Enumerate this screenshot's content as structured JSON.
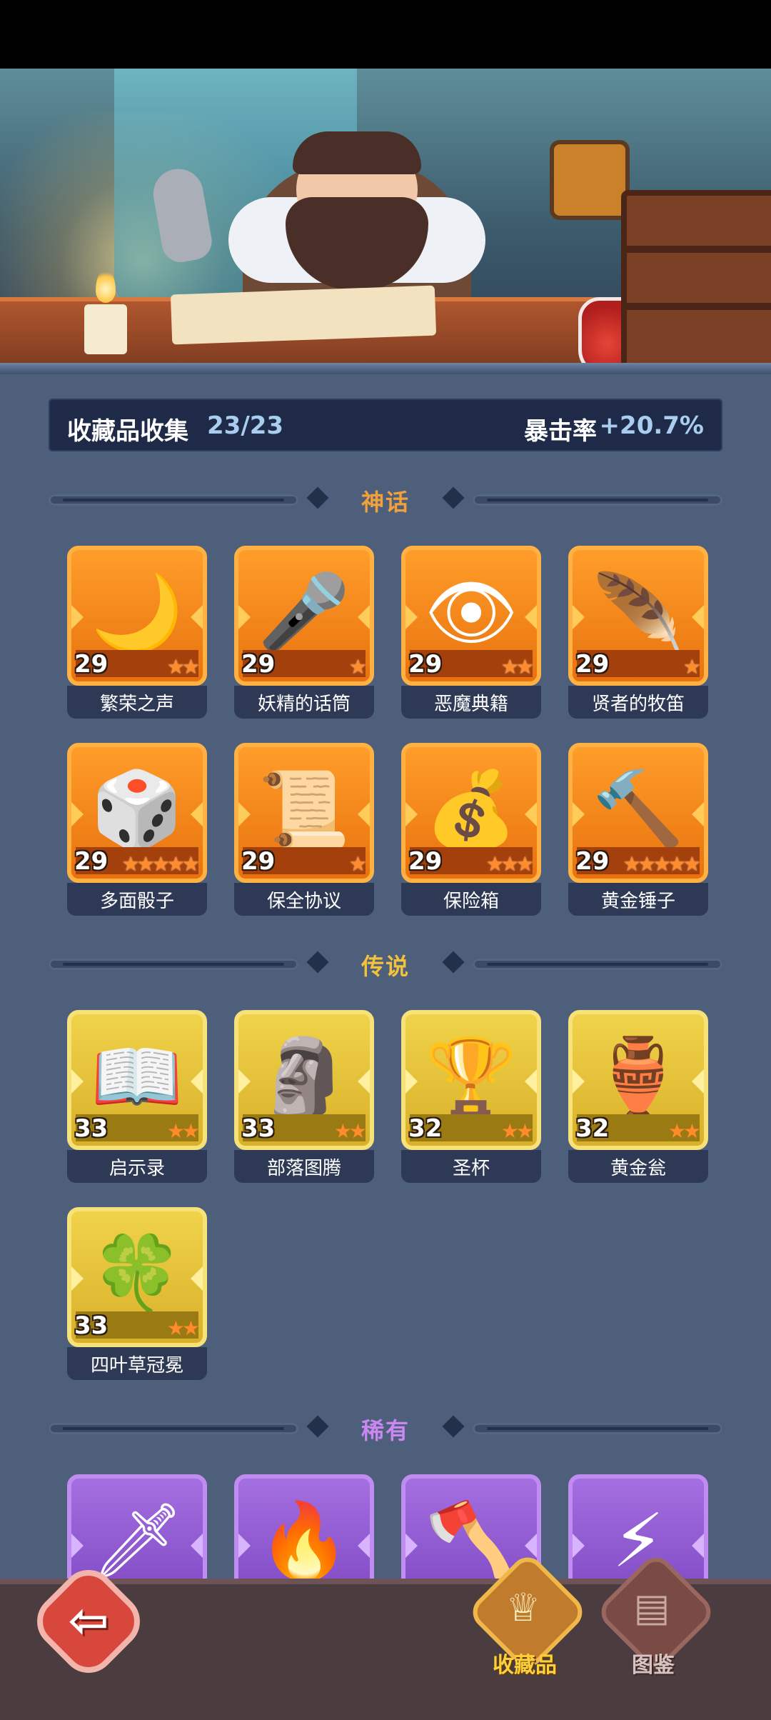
{
  "header": {
    "title": "收藏品收集",
    "count": "23/23",
    "crit_label": "暴击率",
    "crit_value": "+20.7%"
  },
  "sections": {
    "mythic": {
      "title": "神话",
      "items": [
        {
          "name": "繁荣之声",
          "level": "29",
          "stars": 2,
          "icon": "blue-moon-orb-icon"
        },
        {
          "name": "妖精的话筒",
          "level": "29",
          "stars": 1,
          "icon": "fairy-microphone-icon"
        },
        {
          "name": "恶魔典籍",
          "level": "29",
          "stars": 2,
          "icon": "demon-tome-icon"
        },
        {
          "name": "贤者的牧笛",
          "level": "29",
          "stars": 1,
          "icon": "sage-flute-icon"
        },
        {
          "name": "多面骰子",
          "level": "29",
          "stars": 5,
          "icon": "polyhedral-dice-icon"
        },
        {
          "name": "保全协议",
          "level": "29",
          "stars": 1,
          "icon": "security-agreement-icon"
        },
        {
          "name": "保险箱",
          "level": "29",
          "stars": 3,
          "icon": "safe-chest-icon"
        },
        {
          "name": "黄金锤子",
          "level": "29",
          "stars": 5,
          "icon": "golden-hammer-icon"
        }
      ]
    },
    "legend": {
      "title": "传说",
      "items": [
        {
          "name": "启示录",
          "level": "33",
          "stars": 2,
          "icon": "revelation-book-icon"
        },
        {
          "name": "部落图腾",
          "level": "33",
          "stars": 2,
          "icon": "tribal-totem-icon"
        },
        {
          "name": "圣杯",
          "level": "32",
          "stars": 2,
          "icon": "holy-grail-icon"
        },
        {
          "name": "黄金瓮",
          "level": "32",
          "stars": 2,
          "icon": "golden-urn-icon"
        },
        {
          "name": "四叶草冠冕",
          "level": "33",
          "stars": 2,
          "icon": "clover-crown-icon"
        }
      ]
    },
    "rare": {
      "title": "稀有",
      "items": [
        {
          "icon": "frost-dagger-icon"
        },
        {
          "icon": "phoenix-feather-icon"
        },
        {
          "icon": "battle-axe-icon"
        },
        {
          "icon": "lightning-scroll-icon"
        }
      ]
    }
  },
  "glyphs": {
    "blue-moon-orb-icon": "🌙",
    "fairy-microphone-icon": "🎤",
    "demon-tome-icon": "👁",
    "sage-flute-icon": "🪶",
    "polyhedral-dice-icon": "🎲",
    "security-agreement-icon": "📜",
    "safe-chest-icon": "💰",
    "golden-hammer-icon": "🔨",
    "revelation-book-icon": "📖",
    "tribal-totem-icon": "🗿",
    "holy-grail-icon": "🏆",
    "golden-urn-icon": "🏺",
    "clover-crown-icon": "🍀",
    "frost-dagger-icon": "🗡",
    "phoenix-feather-icon": "🔥",
    "battle-axe-icon": "🪓",
    "lightning-scroll-icon": "⚡"
  },
  "bottom_nav": {
    "back_icon": "back-arrow-icon",
    "tabs": [
      {
        "label": "收藏品",
        "icon": "collection-icon",
        "active": true
      },
      {
        "label": "图鉴",
        "icon": "codex-book-icon",
        "active": false
      }
    ]
  },
  "colors": {
    "mythic": "#f2a13a",
    "legend": "#f2c23a",
    "rare": "#c988f0",
    "accent_value": "#a9cdee",
    "background": "#4e5f7c"
  }
}
